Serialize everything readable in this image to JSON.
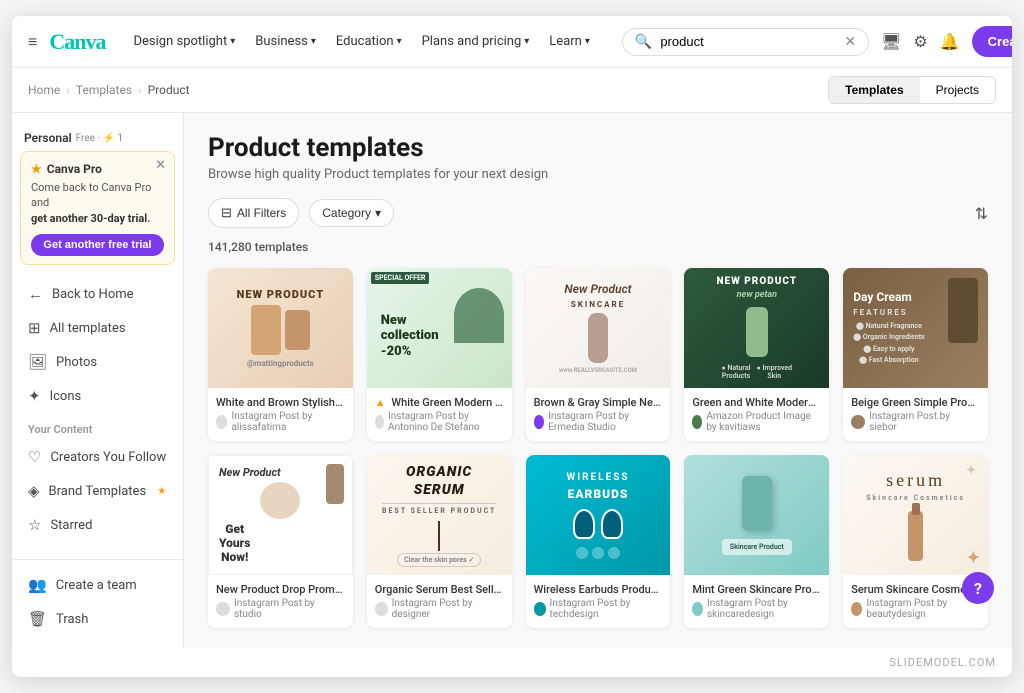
{
  "browser": {
    "title": "Product templates - Canva"
  },
  "nav": {
    "hamburger_icon": "≡",
    "logo_text": "Canva",
    "links": [
      {
        "label": "Design spotlight",
        "has_chevron": true
      },
      {
        "label": "Business",
        "has_chevron": true
      },
      {
        "label": "Education",
        "has_chevron": true
      },
      {
        "label": "Plans and pricing",
        "has_chevron": true
      },
      {
        "label": "Learn",
        "has_chevron": true
      }
    ],
    "search_placeholder": "product",
    "search_value": "product",
    "icons": [
      "🖥",
      "⚙",
      "🔔"
    ],
    "create_button": "Create a design"
  },
  "breadcrumb": {
    "items": [
      "Home",
      "Templates",
      "Product"
    ]
  },
  "tabs": [
    {
      "label": "Templates",
      "active": true
    },
    {
      "label": "Projects",
      "active": false
    }
  ],
  "sidebar": {
    "promo": {
      "title": "Canva Pro",
      "text_line1": "Come back to Canva Pro and",
      "text_line2": "get another 30-day trial.",
      "button_label": "Get another free trial"
    },
    "nav_items": [
      {
        "icon": "←",
        "label": "Back to Home"
      },
      {
        "icon": "⊞",
        "label": "All templates"
      },
      {
        "icon": "🖼",
        "label": "Photos"
      },
      {
        "icon": "✦",
        "label": "Icons"
      }
    ],
    "section_label": "Your Content",
    "content_items": [
      {
        "icon": "♡",
        "label": "Creators You Follow"
      },
      {
        "icon": "◈",
        "label": "Brand Templates",
        "badge": "★"
      },
      {
        "icon": "☆",
        "label": "Starred"
      }
    ],
    "bottom_items": [
      {
        "icon": "👥",
        "label": "Create a team"
      },
      {
        "icon": "🗑",
        "label": "Trash"
      }
    ]
  },
  "content": {
    "page_title": "Product templates",
    "page_subtitle": "Browse high quality Product templates for your next design",
    "filter_label": "All Filters",
    "category_label": "Category",
    "template_count": "141,280 templates",
    "templates_row1": [
      {
        "title": "White and Brown Stylish Appliance...",
        "author": "Instagram Post by alissafatima",
        "bg_class": "bg-beige-product",
        "card_text": "NEW PRODUCT\n@mattingproducts",
        "text_color": "#5a3a1a"
      },
      {
        "title": "White Green Modern Product Mark...",
        "author": "Instagram Post by Antonino De Stefano",
        "bg_class": "bg-green-product",
        "card_text": "SPECIAL OFFER\nNew\ncollection\n-20%",
        "text_color": "#1a3a1a",
        "has_badge": true
      },
      {
        "title": "Brown & Gray Simple New Skincare...",
        "author": "Instagram Post by Ermedia Studio",
        "bg_class": "bg-light-product",
        "card_text": "New Product\nSKINCARE\nwww.REALLYGREASITE.COM",
        "text_color": "#5a4030"
      },
      {
        "title": "Green and White Modern Skincare ...",
        "author": "Amazon Product Image by kavitiaws",
        "bg_class": "bg-dark-green",
        "card_text": "NEW PRODUCT\nnew petan",
        "text_color": "#ffffff"
      },
      {
        "title": "Beige Green Simple Product Featur...",
        "author": "Instagram Post by siebor",
        "bg_class": "bg-warm-brown",
        "card_text": "Day Cream\nFEATURES",
        "text_color": "#ffffff"
      }
    ],
    "templates_row2": [
      {
        "title": "New Product Drop Promo...",
        "author": "Instagram Post by studio",
        "bg_class": "bg-white-product",
        "card_text": "New Product\nGet\nYours\nNow!",
        "text_color": "#333"
      },
      {
        "title": "Organic Serum Best Seller...",
        "author": "Instagram Post by designer",
        "bg_class": "bg-cream-product",
        "card_text": "ORGANIC\nSERUM\nBEST SELLER PRODUCT",
        "text_color": "#333"
      },
      {
        "title": "Wireless Earbuds Product...",
        "author": "Instagram Post by techdesign",
        "bg_class": "bg-cyan-product",
        "card_text": "WIRELESS\nEARBUDS",
        "text_color": "#ffffff"
      },
      {
        "title": "Mint Green Skincare Product...",
        "author": "Instagram Post by skincaredesign",
        "bg_class": "bg-mint-product",
        "card_text": "",
        "text_color": "#333"
      },
      {
        "title": "Serum Skincare Cosmetics...",
        "author": "Instagram Post by beautydesign",
        "bg_class": "bg-cream-product",
        "card_text": "serum\nSkincare Cosmetics",
        "text_color": "#5a3a1a"
      }
    ]
  },
  "watermark": "SLIDEMODEL.COM",
  "help_button": "?"
}
